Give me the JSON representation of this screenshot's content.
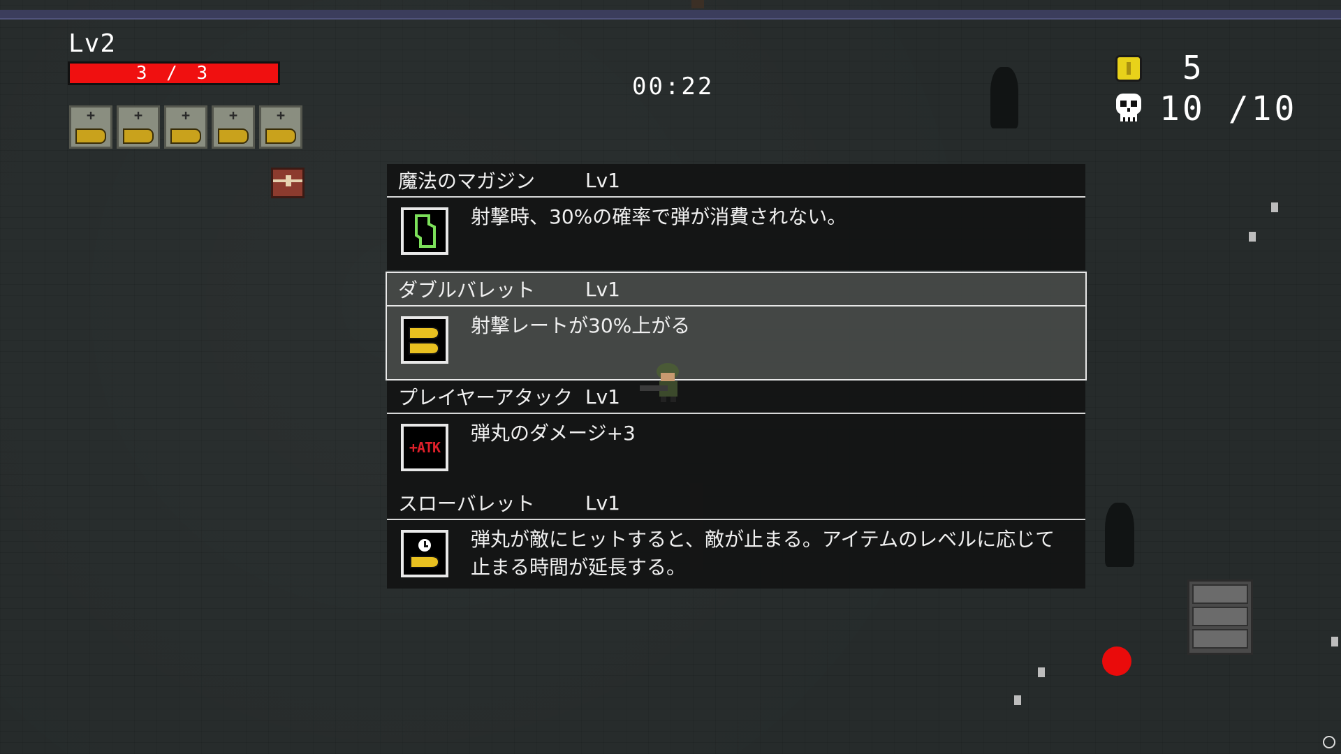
{
  "hud": {
    "level_label": "Lv2",
    "hp_text": "3 / 3",
    "hp_fraction": 1.0,
    "timer": "00:22",
    "coins": "5",
    "kills": "10 /10",
    "ammo_slots": 5,
    "ammo_plus": "+"
  },
  "upgrades": [
    {
      "name": "魔法のマガジン",
      "level": "Lv1",
      "description": "射撃時、30%の確率で弾が消費されない。",
      "icon": "magazine-icon"
    },
    {
      "name": "ダブルバレット",
      "level": "Lv1",
      "description": "射撃レートが30%上がる",
      "icon": "double-bullet-icon",
      "selected": true
    },
    {
      "name": "プレイヤーアタック",
      "level": "Lv1",
      "description": "弾丸のダメージ+3",
      "icon": "atk-icon",
      "icon_text": "+ATK"
    },
    {
      "name": "スローバレット",
      "level": "Lv1",
      "description": "弾丸が敵にヒットすると、敵が止まる。アイテムのレベルに応じて止まる時間が延長する。",
      "icon": "slow-bullet-icon"
    }
  ],
  "colors": {
    "hp": "#f01010",
    "coin": "#e8d21a",
    "enemy": "#ea0b0b",
    "bullet": "#c9a21c",
    "magazine_green": "#7ce05a",
    "atk_red": "#e0202a"
  }
}
